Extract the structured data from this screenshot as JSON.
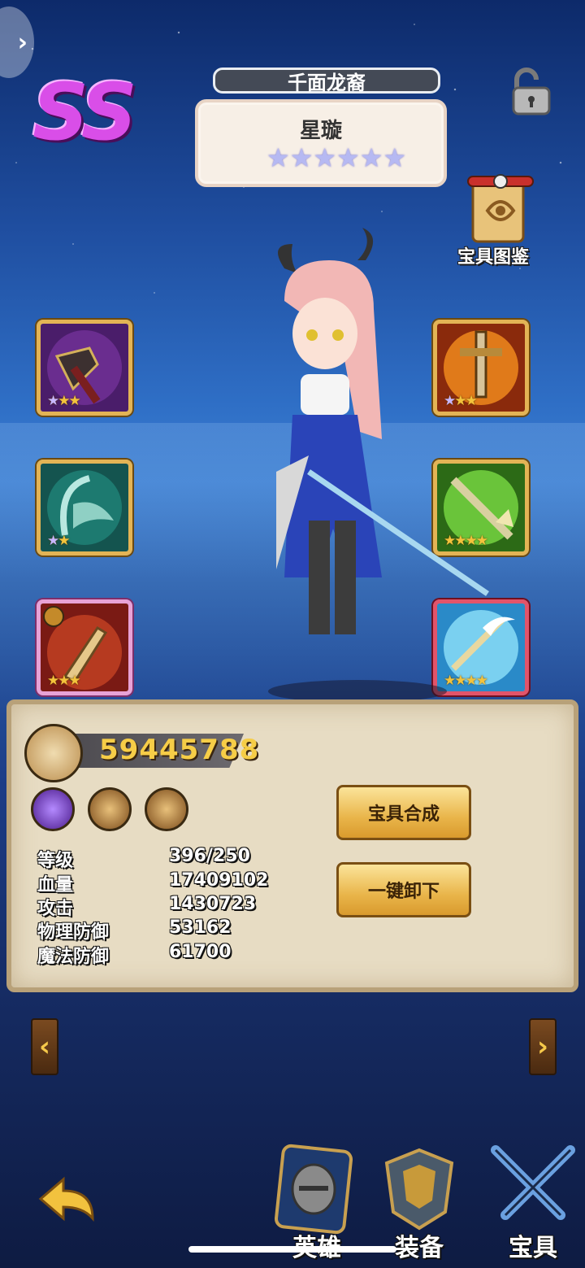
{
  "header": {
    "rank": "SS",
    "title": "千面龙裔",
    "hero_name": "星璇",
    "hero_stars": 6
  },
  "side": {
    "scroll_label": "宝具图鉴"
  },
  "slots": [
    {
      "stars": 3,
      "star_colors": [
        "#c8b6ff",
        "#f3c33c",
        "#f3c33c"
      ]
    },
    {
      "stars": 3,
      "star_colors": [
        "#c8b6ff",
        "#f3c33c",
        "#f3c33c"
      ]
    },
    {
      "stars": 2,
      "star_colors": [
        "#c8b6ff",
        "#f3c33c"
      ]
    },
    {
      "stars": 4,
      "star_colors": [
        "#f3c33c",
        "#f3c33c",
        "#f3c33c",
        "#f3c33c"
      ]
    },
    {
      "stars": 3,
      "star_colors": [
        "#f3c33c",
        "#f3c33c",
        "#f3c33c"
      ]
    },
    {
      "stars": 4,
      "star_colors": [
        "#f3c33c",
        "#f3c33c",
        "#f3c33c",
        "#f3c33c"
      ]
    }
  ],
  "panel": {
    "power": "59445788",
    "stats": [
      {
        "label": "等级",
        "value": "396/250"
      },
      {
        "label": "血量",
        "value": "17409102"
      },
      {
        "label": "攻击",
        "value": "1430723"
      },
      {
        "label": "物理防御",
        "value": "53162"
      },
      {
        "label": "魔法防御",
        "value": "61700"
      }
    ],
    "buttons": {
      "synthesize": "宝具合成",
      "unequip_all": "一键卸下"
    }
  },
  "nav": {
    "prev": "‹",
    "next": "›",
    "tabs": [
      {
        "label": "英雄"
      },
      {
        "label": "装备"
      },
      {
        "label": "宝具"
      }
    ]
  }
}
